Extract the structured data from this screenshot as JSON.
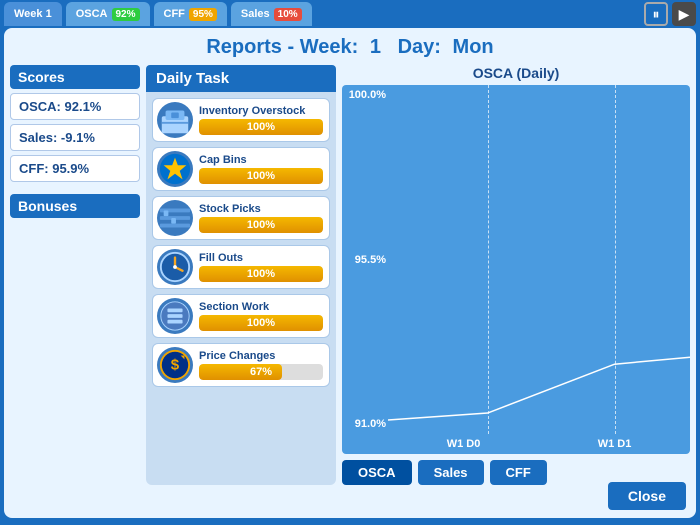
{
  "topbar": {
    "tabs": [
      {
        "label": "Week 1",
        "badge": "",
        "active": true
      },
      {
        "label": "OSCA",
        "badge": "92%",
        "badge_color": "green"
      },
      {
        "label": "CFF",
        "badge": "95%",
        "badge_color": "yellow"
      },
      {
        "label": "Sales",
        "badge": "10%",
        "badge_color": "red"
      }
    ]
  },
  "title": {
    "prefix": "Reports - Week:",
    "week": "1",
    "day_label": "Day:",
    "day": "Mon"
  },
  "scores": {
    "heading": "Scores",
    "items": [
      {
        "label": "OSCA: 92.1%"
      },
      {
        "label": "Sales: -9.1%"
      },
      {
        "label": "CFF:  95.9%"
      }
    ],
    "bonuses_heading": "Bonuses"
  },
  "daily_task": {
    "title": "Daily Task",
    "tasks": [
      {
        "name": "Inventory Overstock",
        "pct": 100,
        "icon": "📦"
      },
      {
        "name": "Cap Bins",
        "pct": 100,
        "icon": "🏪"
      },
      {
        "name": "Stock Picks",
        "pct": 100,
        "icon": "🔍"
      },
      {
        "name": "Fill Outs",
        "pct": 100,
        "icon": "⏱️"
      },
      {
        "name": "Section Work",
        "pct": 100,
        "icon": "🔧"
      },
      {
        "name": "Price Changes",
        "pct": 67,
        "icon": "💲"
      }
    ]
  },
  "chart": {
    "title": "OSCA (Daily)",
    "y_labels": [
      "100.0%",
      "95.5%",
      "91.0%"
    ],
    "x_labels": [
      "W1 D0",
      "W1 D1"
    ],
    "buttons": [
      "OSCA",
      "Sales",
      "CFF"
    ],
    "active_button": "OSCA"
  },
  "close_button": "Close"
}
